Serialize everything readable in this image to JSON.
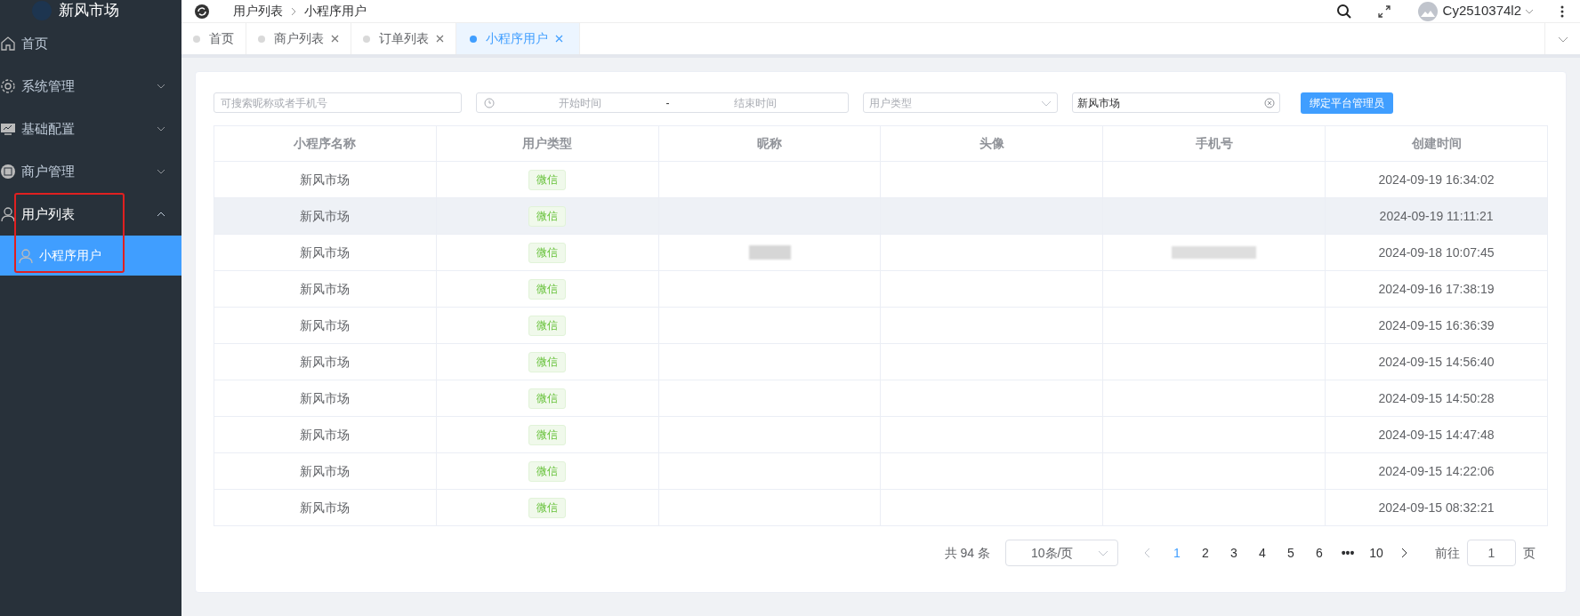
{
  "logo": {
    "title": "新风市场"
  },
  "sidebar": {
    "items": [
      {
        "label": "首页",
        "expanded": false,
        "has_children": false,
        "selected": false
      },
      {
        "label": "系统管理",
        "expanded": false,
        "has_children": true,
        "selected": false
      },
      {
        "label": "基础配置",
        "expanded": false,
        "has_children": true,
        "selected": false
      },
      {
        "label": "商户管理",
        "expanded": false,
        "has_children": true,
        "selected": false
      },
      {
        "label": "用户列表",
        "expanded": true,
        "has_children": true,
        "selected": false,
        "children": [
          {
            "label": "小程序用户",
            "selected": true
          }
        ]
      }
    ]
  },
  "breadcrumb": [
    "用户列表",
    "小程序用户"
  ],
  "user": {
    "name": "Cy2510374l2"
  },
  "tabs": [
    {
      "label": "首页",
      "closable": false,
      "selected": false
    },
    {
      "label": "商户列表",
      "closable": true,
      "selected": false
    },
    {
      "label": "订单列表",
      "closable": true,
      "selected": false
    },
    {
      "label": "小程序用户",
      "closable": true,
      "selected": true
    }
  ],
  "filters": {
    "search": {
      "placeholder": "可搜索昵称或者手机号"
    },
    "date_range": {
      "start_placeholder": "开始时间",
      "separator": "-",
      "end_placeholder": "结束时间"
    },
    "user_type": {
      "placeholder": "用户类型"
    },
    "app": {
      "value": "新风市场"
    },
    "bind_button": "绑定平台管理员"
  },
  "table": {
    "columns": [
      "小程序名称",
      "用户类型",
      "昵称",
      "头像",
      "手机号",
      "创建时间"
    ],
    "rows": [
      {
        "app": "新风市场",
        "type": "微信",
        "nickname_redacted": false,
        "phone_redacted": false,
        "created": "2024-09-19 16:34:02",
        "hovered": false
      },
      {
        "app": "新风市场",
        "type": "微信",
        "nickname_redacted": false,
        "phone_redacted": false,
        "created": "2024-09-19 11:11:21",
        "hovered": true
      },
      {
        "app": "新风市场",
        "type": "微信",
        "nickname_redacted": true,
        "phone_redacted": true,
        "created": "2024-09-18 10:07:45",
        "hovered": false
      },
      {
        "app": "新风市场",
        "type": "微信",
        "nickname_redacted": false,
        "phone_redacted": false,
        "created": "2024-09-16 17:38:19",
        "hovered": false
      },
      {
        "app": "新风市场",
        "type": "微信",
        "nickname_redacted": false,
        "phone_redacted": false,
        "created": "2024-09-15 16:36:39",
        "hovered": false
      },
      {
        "app": "新风市场",
        "type": "微信",
        "nickname_redacted": false,
        "phone_redacted": false,
        "created": "2024-09-15 14:56:40",
        "hovered": false
      },
      {
        "app": "新风市场",
        "type": "微信",
        "nickname_redacted": false,
        "phone_redacted": false,
        "created": "2024-09-15 14:50:28",
        "hovered": false
      },
      {
        "app": "新风市场",
        "type": "微信",
        "nickname_redacted": false,
        "phone_redacted": false,
        "created": "2024-09-15 14:47:48",
        "hovered": false
      },
      {
        "app": "新风市场",
        "type": "微信",
        "nickname_redacted": false,
        "phone_redacted": false,
        "created": "2024-09-15 14:22:06",
        "hovered": false
      },
      {
        "app": "新风市场",
        "type": "微信",
        "nickname_redacted": false,
        "phone_redacted": false,
        "created": "2024-09-15 08:32:21",
        "hovered": false
      }
    ]
  },
  "pagination": {
    "total": "共 94 条",
    "page_size": "10条/页",
    "pages": [
      {
        "label": "1",
        "kind": "page",
        "selected": true
      },
      {
        "label": "2",
        "kind": "page",
        "selected": false
      },
      {
        "label": "3",
        "kind": "page",
        "selected": false
      },
      {
        "label": "4",
        "kind": "page",
        "selected": false
      },
      {
        "label": "5",
        "kind": "page",
        "selected": false
      },
      {
        "label": "6",
        "kind": "page",
        "selected": false
      },
      {
        "label": "•••",
        "kind": "more",
        "selected": false
      },
      {
        "label": "10",
        "kind": "page",
        "selected": false
      }
    ],
    "goto_label": "前往",
    "goto_value": "1",
    "goto_suffix": "页"
  }
}
